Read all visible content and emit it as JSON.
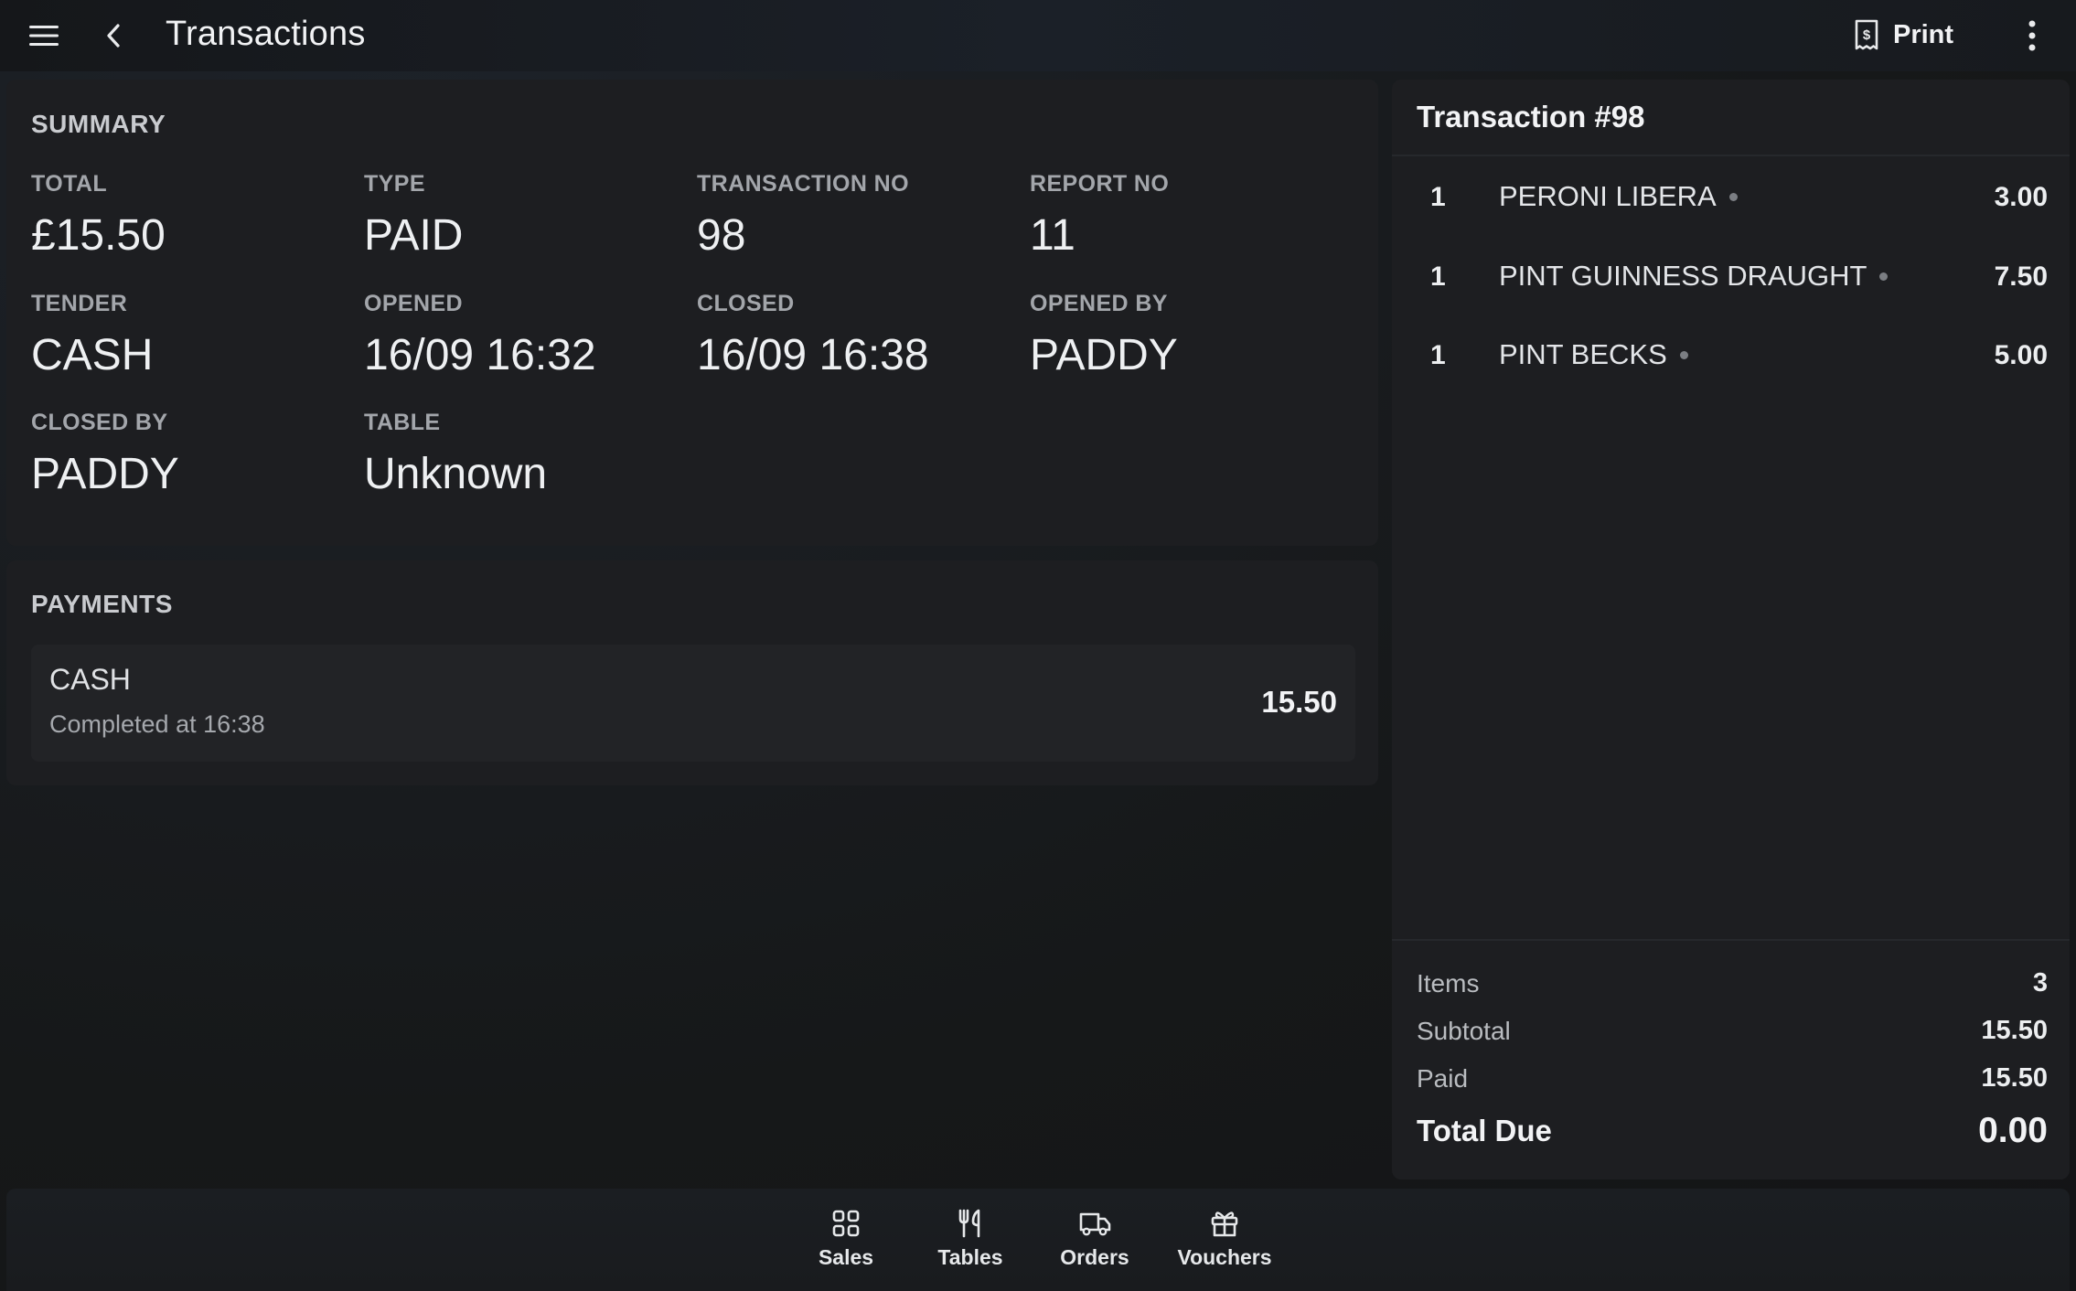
{
  "header": {
    "title": "Transactions",
    "menu_icon": "hamburger-menu-icon",
    "back_icon": "chevron-left-icon",
    "print_label": "Print",
    "print_icon": "receipt-icon",
    "more_icon": "more-vertical-icon"
  },
  "summary": {
    "title": "SUMMARY",
    "fields": {
      "total": {
        "label": "TOTAL",
        "value": "£15.50"
      },
      "type": {
        "label": "TYPE",
        "value": "PAID"
      },
      "transaction_no": {
        "label": "TRANSACTION NO",
        "value": "98"
      },
      "report_no": {
        "label": "REPORT NO",
        "value": "11"
      },
      "tender": {
        "label": "TENDER",
        "value": "CASH"
      },
      "opened": {
        "label": "OPENED",
        "value": "16/09 16:32"
      },
      "closed": {
        "label": "CLOSED",
        "value": "16/09 16:38"
      },
      "opened_by": {
        "label": "OPENED BY",
        "value": "PADDY"
      },
      "closed_by": {
        "label": "CLOSED BY",
        "value": "PADDY"
      },
      "table": {
        "label": "TABLE",
        "value": "Unknown"
      }
    }
  },
  "payments": {
    "title": "PAYMENTS",
    "items": [
      {
        "tender": "CASH",
        "status": "Completed at 16:38",
        "amount": "15.50"
      }
    ]
  },
  "transaction": {
    "title": "Transaction #98",
    "items": [
      {
        "qty": "1",
        "name": "PERONI LIBERA",
        "price": "3.00"
      },
      {
        "qty": "1",
        "name": "PINT GUINNESS DRAUGHT",
        "price": "7.50"
      },
      {
        "qty": "1",
        "name": "PINT BECKS",
        "price": "5.00"
      }
    ],
    "totals": {
      "items": {
        "label": "Items",
        "value": "3"
      },
      "subtotal": {
        "label": "Subtotal",
        "value": "15.50"
      },
      "paid": {
        "label": "Paid",
        "value": "15.50"
      },
      "total_due": {
        "label": "Total Due",
        "value": "0.00"
      }
    }
  },
  "bottom_nav": {
    "items": [
      {
        "label": "Sales",
        "icon": "grid-icon"
      },
      {
        "label": "Tables",
        "icon": "cutlery-icon"
      },
      {
        "label": "Orders",
        "icon": "delivery-truck-icon"
      },
      {
        "label": "Vouchers",
        "icon": "gift-icon"
      }
    ]
  },
  "colors": {
    "background": "#17191c",
    "panel": "#1d1e21",
    "card": "#222326",
    "text_primary": "#eef0f2",
    "text_muted": "#a3a6ab"
  }
}
